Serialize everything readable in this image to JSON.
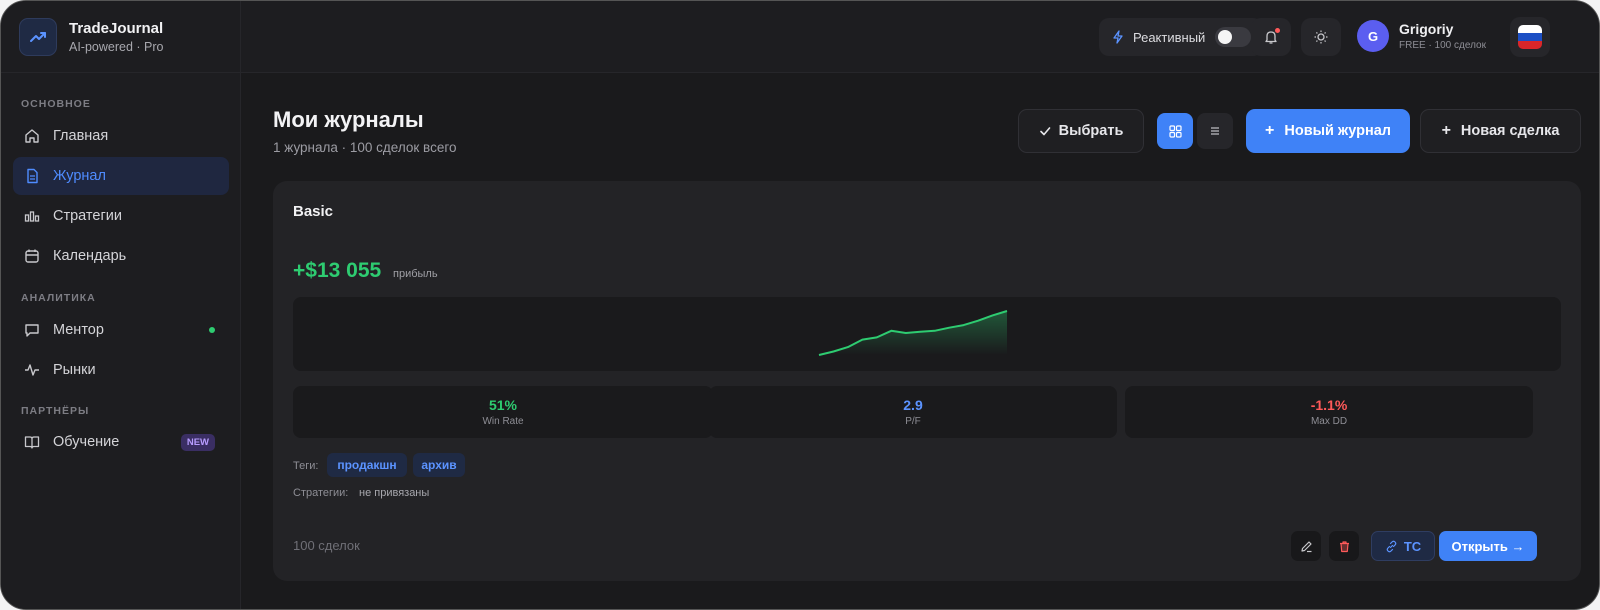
{
  "app": {
    "name": "TradeJournal",
    "subtitle": "AI-powered · Pro"
  },
  "sidebar": {
    "sections": [
      {
        "label": "ОСНОВНОЕ"
      },
      {
        "label": "АНАЛИТИКА"
      },
      {
        "label": "ПАРТНЁРЫ"
      }
    ],
    "items": [
      {
        "label": "Главная",
        "icon": "home-icon"
      },
      {
        "label": "Журнал",
        "icon": "document-icon",
        "active": true
      },
      {
        "label": "Стратегии",
        "icon": "strategy-icon"
      },
      {
        "label": "Календарь",
        "icon": "calendar-icon"
      },
      {
        "label": "Ментор",
        "icon": "chat-icon",
        "status": "online"
      },
      {
        "label": "Рынки",
        "icon": "pulse-icon"
      },
      {
        "label": "Обучение",
        "icon": "book-icon",
        "badge": "NEW"
      }
    ]
  },
  "topbar": {
    "mode_label": "Реактивный",
    "mode_on": false,
    "user": {
      "initial": "G",
      "name": "Grigoriy",
      "plan": "FREE · 100 сделок"
    },
    "language_flag": "ru-flag-icon"
  },
  "main": {
    "title": "Мои журналы",
    "subtitle": "1 журнала · 100 сделок всего",
    "buttons": {
      "select": "Выбрать",
      "new_journal": "Новый журнал",
      "new_trade": "Новая сделка"
    },
    "view_mode": "grid"
  },
  "journal": {
    "name": "Basic",
    "profit": "+$13 055",
    "profit_label": "прибыль",
    "stats": [
      {
        "value": "51%",
        "label": "Win Rate",
        "color": "#2ecc71"
      },
      {
        "value": "2.9",
        "label": "P/F",
        "color": "#5b93ff"
      },
      {
        "value": "-1.1%",
        "label": "Max DD",
        "color": "#ff5a5a"
      }
    ],
    "tags_label": "Теги:",
    "tags": [
      "продакшн",
      "архив"
    ],
    "strategies_label": "Стратегии:",
    "strategies_value": "не привязаны",
    "trades_count": "100 сделок",
    "tc_label": "ТС",
    "open_label": "Открыть →",
    "equity": [
      0,
      8,
      18,
      35,
      40,
      55,
      50,
      53,
      55,
      62,
      68,
      78,
      90,
      100
    ]
  },
  "colors": {
    "accent": "#3f82f7",
    "profit": "#2ecc71",
    "loss": "#ff5a5a",
    "bg": "#1a1a1c"
  }
}
